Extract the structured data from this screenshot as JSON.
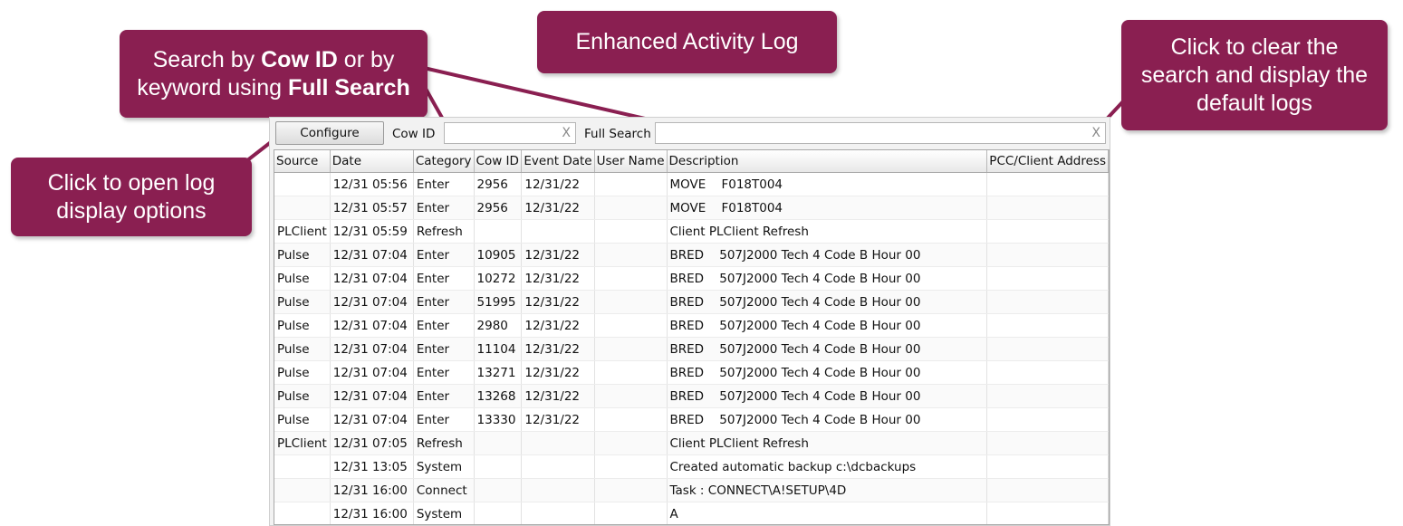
{
  "callouts": {
    "title": "Enhanced Activity Log",
    "search": {
      "line1_pre": "Search by ",
      "line1_bold": "Cow ID",
      "line1_post": " or by",
      "line2_pre": "keyword using ",
      "line2_bold": "Full Search"
    },
    "configure": {
      "line1": "Click to open log",
      "line2": "display options"
    },
    "clear": {
      "line1": "Click to clear the",
      "line2": "search and display the",
      "line3": "default logs"
    }
  },
  "colors": {
    "callout_bg": "#8a1f51",
    "callout_text": "#ffffff"
  },
  "toolbar": {
    "configure_label": "Configure",
    "cowid_label": "Cow ID",
    "cowid_value": "",
    "cowid_clear": "X",
    "fullsearch_label": "Full Search",
    "fullsearch_value": "",
    "fullsearch_clear": "X"
  },
  "table": {
    "columns": [
      "Source",
      "Date",
      "Category",
      "Cow ID",
      "Event Date",
      "User Name",
      "Description",
      "PCC/Client Address"
    ],
    "rows": [
      [
        "",
        "12/31 05:56",
        "Enter",
        "2956",
        "12/31/22",
        "",
        "MOVE    F018T004",
        ""
      ],
      [
        "",
        "12/31 05:57",
        "Enter",
        "2956",
        "12/31/22",
        "",
        "MOVE    F018T004",
        ""
      ],
      [
        "PLClient",
        "12/31 05:59",
        "Refresh",
        "",
        "",
        "",
        "Client PLClient Refresh",
        ""
      ],
      [
        "Pulse",
        "12/31 07:04",
        "Enter",
        "10905",
        "12/31/22",
        "",
        "BRED    507J2000 Tech 4 Code B Hour 00",
        ""
      ],
      [
        "Pulse",
        "12/31 07:04",
        "Enter",
        "10272",
        "12/31/22",
        "",
        "BRED    507J2000 Tech 4 Code B Hour 00",
        ""
      ],
      [
        "Pulse",
        "12/31 07:04",
        "Enter",
        "51995",
        "12/31/22",
        "",
        "BRED    507J2000 Tech 4 Code B Hour 00",
        ""
      ],
      [
        "Pulse",
        "12/31 07:04",
        "Enter",
        "2980",
        "12/31/22",
        "",
        "BRED    507J2000 Tech 4 Code B Hour 00",
        ""
      ],
      [
        "Pulse",
        "12/31 07:04",
        "Enter",
        "11104",
        "12/31/22",
        "",
        "BRED    507J2000 Tech 4 Code B Hour 00",
        ""
      ],
      [
        "Pulse",
        "12/31 07:04",
        "Enter",
        "13271",
        "12/31/22",
        "",
        "BRED    507J2000 Tech 4 Code B Hour 00",
        ""
      ],
      [
        "Pulse",
        "12/31 07:04",
        "Enter",
        "13268",
        "12/31/22",
        "",
        "BRED    507J2000 Tech 4 Code B Hour 00",
        ""
      ],
      [
        "Pulse",
        "12/31 07:04",
        "Enter",
        "13330",
        "12/31/22",
        "",
        "BRED    507J2000 Tech 4 Code B Hour 00",
        ""
      ],
      [
        "PLClient",
        "12/31 07:05",
        "Refresh",
        "",
        "",
        "",
        "Client PLClient Refresh",
        ""
      ],
      [
        "",
        "12/31 13:05",
        "System",
        "",
        "",
        "",
        "Created automatic backup c:\\dcbackups",
        ""
      ],
      [
        "",
        "12/31 16:00",
        "Connect",
        "",
        "",
        "",
        "Task : CONNECT\\A!SETUP\\4D",
        ""
      ],
      [
        "",
        "12/31 16:00",
        "System",
        "",
        "",
        "",
        "A",
        ""
      ]
    ]
  }
}
